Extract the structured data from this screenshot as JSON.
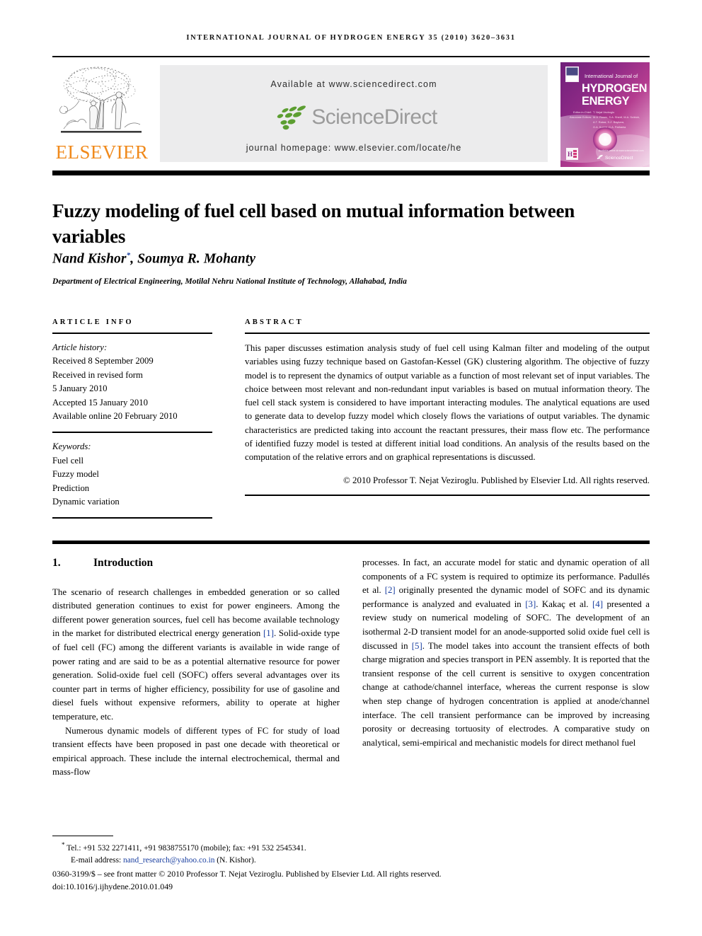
{
  "running_head": "International Journal of Hydrogen Energy 35 (2010) 3620–3631",
  "banner": {
    "publisher_name": "ELSEVIER",
    "available_at": "Available at www.sciencedirect.com",
    "sciencedirect_wordmark": "ScienceDirect",
    "journal_homepage": "journal homepage: www.elsevier.com/locate/he",
    "cover": {
      "line1": "International Journal of",
      "line2": "HYDROGEN",
      "line3": "ENERGY",
      "editor_label": "Editor-in-Chief:",
      "editor_name": "T. Nejat Veziroglu",
      "assoc_label": "Associate Editors:",
      "assoc_line1": "M.A. Rosen, S.A. Sherif, M.A. Scibioh,",
      "assoc_line2": "A.T. Raissi, S.Z. Baykara,",
      "assoc_line3": "G.A. Kumar, D.A. Pathania",
      "sd_caption": "Available online at www.sciencedirect.com",
      "sd_wordmark": "ScienceDirect"
    }
  },
  "article": {
    "title": "Fuzzy modeling of fuel cell based on mutual information between variables",
    "authors": "Nand Kishor",
    "author_star": "*",
    "authors_rest": ", Soumya R. Mohanty",
    "affiliation": "Department of Electrical Engineering, Motilal Nehru National Institute of Technology, Allahabad, India"
  },
  "info": {
    "heading": "Article info",
    "history_label": "Article history:",
    "history": [
      "Received 8 September 2009",
      "Received in revised form",
      "5 January 2010",
      "Accepted 15 January 2010",
      "Available online 20 February 2010"
    ],
    "keywords_label": "Keywords:",
    "keywords": [
      "Fuel cell",
      "Fuzzy model",
      "Prediction",
      "Dynamic variation"
    ]
  },
  "abstract": {
    "heading": "Abstract",
    "text": "This paper discusses estimation analysis study of fuel cell using Kalman filter and modeling of the output variables using fuzzy technique based on Gastofan-Kessel (GK) clustering algorithm. The objective of fuzzy model is to represent the dynamics of output variable as a function of most relevant set of input variables. The choice between most relevant and non-redundant input variables is based on mutual information theory. The fuel cell stack system is considered to have important interacting modules. The analytical equations are used to generate data to develop fuzzy model which closely flows the variations of output variables. The dynamic characteristics are predicted taking into account the reactant pressures, their mass flow etc. The performance of identified fuzzy model is tested at different initial load conditions. An analysis of the results based on the computation of the relative errors and on graphical representations is discussed.",
    "copyright": "© 2010 Professor T. Nejat Veziroglu. Published by Elsevier Ltd. All rights reserved."
  },
  "body": {
    "section_number": "1.",
    "section_title": "Introduction",
    "left_para1_a": "The scenario of research challenges in embedded generation or so called distributed generation continues to exist for power engineers. Among the different power generation sources, fuel cell has become available technology in the market for distributed electrical energy generation ",
    "left_ref1": "[1]",
    "left_para1_b": ". Solid-oxide type of fuel cell (FC) among the different variants is available in wide range of power rating and are said to be as a potential alternative resource for power generation. Solid-oxide fuel cell (SOFC) offers several advantages over its counter part in terms of higher efficiency, possibility for use of gasoline and diesel fuels without expensive reformers, ability to operate at higher temperature, etc.",
    "left_para2": "Numerous dynamic models of different types of FC for study of load transient effects have been proposed in past one decade with theoretical or empirical approach. These include the internal electrochemical, thermal and mass-flow",
    "right_a": "processes. In fact, an accurate model for static and dynamic operation of all components of a FC system is required to optimize its performance. Padullés et al. ",
    "right_ref2": "[2]",
    "right_b": " originally presented the dynamic model of SOFC and its dynamic performance is analyzed and evaluated in ",
    "right_ref3": "[3]",
    "right_c": ". Kakaç et al. ",
    "right_ref4": "[4]",
    "right_d": " presented a review study on numerical modeling of SOFC. The development of an isothermal 2-D transient model for an anode-supported solid oxide fuel cell is discussed in ",
    "right_ref5": "[5]",
    "right_e": ". The model takes into account the transient effects of both charge migration and species transport in PEN assembly. It is reported that the transient response of the cell current is sensitive to oxygen concentration change at cathode/channel interface, whereas the current response is slow when step change of hydrogen concentration is applied at anode/channel interface. The cell transient performance can be improved by increasing porosity or decreasing tortuosity of electrodes. A comparative study on analytical, semi-empirical and mechanistic models for direct methanol fuel"
  },
  "footnotes": {
    "star": "*",
    "tel_line": " Tel.: +91 532 2271411, +91 9838755170 (mobile); fax: +91 532 2545341.",
    "email_label": "E-mail address: ",
    "email": "nand_research@yahoo.co.in",
    "email_suffix": " (N. Kishor).",
    "imprint": "0360-3199/$ – see front matter © 2010 Professor T. Nejat Veziroglu. Published by Elsevier Ltd. All rights reserved.",
    "doi": "doi:10.1016/j.ijhydene.2010.01.049"
  },
  "colors": {
    "elsevier_orange": "#F08A1C",
    "link_blue": "#1a3fa0",
    "sciencedirect_green": "#5C9E31",
    "sciencedirect_gray": "#9b9b9b",
    "banner_bg": "#ececed"
  }
}
